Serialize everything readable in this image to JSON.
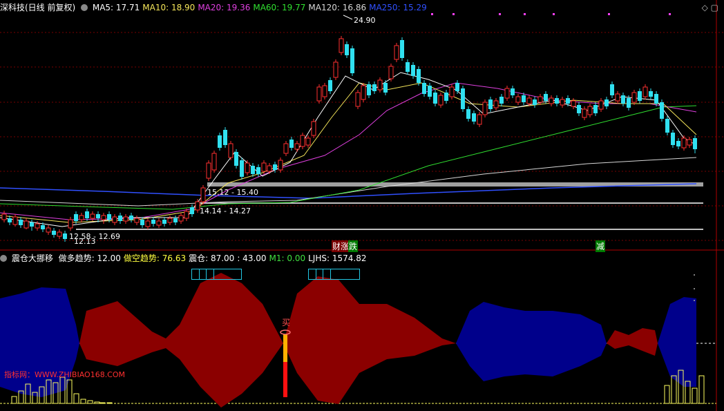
{
  "main_header": {
    "title": "深科技(日线 前复权)",
    "ma": [
      {
        "label": "MA5: 17.71",
        "color": "#ffffff"
      },
      {
        "label": "MA10: 18.90",
        "color": "#f5e65a"
      },
      {
        "label": "MA20: 19.36",
        "color": "#e040e0"
      },
      {
        "label": "MA60: 19.77",
        "color": "#30e030"
      },
      {
        "label": "MA120: 16.86",
        "color": "#d8d8d8"
      },
      {
        "label": "MA250: 15.29",
        "color": "#3050ff"
      }
    ]
  },
  "price_annotations": {
    "high": "24.90",
    "zone1": "15.12 - 15.40",
    "zone2": "14.14 - 14.27",
    "low": "12.13",
    "zone3": "12.58 - 12.69"
  },
  "events": [
    {
      "text": "财",
      "color": "#ffffff",
      "bg": "#7a0000"
    },
    {
      "text": "涨",
      "color": "#ffffff",
      "bg": "#7a0000"
    },
    {
      "text": "跌",
      "color": "#ffffff",
      "bg": "#007a00"
    },
    {
      "text": "减",
      "color": "#ffffff",
      "bg": "#007a00"
    }
  ],
  "indicator_header": {
    "name": "震仓大挪移",
    "items": [
      {
        "label": "做多趋势: 12.00",
        "color": "#ffffff"
      },
      {
        "label": "做空趋势: 76.63",
        "color": "#ffff40"
      },
      {
        "label": "震仓: 87.00",
        "color": "#ffffff"
      },
      {
        "label": ": 43.00",
        "color": "#ffffff"
      },
      {
        "label": "M1: 0.00",
        "color": "#40e040"
      },
      {
        "label": "LJHS: 1574.82",
        "color": "#ffffff"
      }
    ]
  },
  "buy_label": "买",
  "watermark": "指标网：WWW.ZHIBIAO168.COM",
  "colors": {
    "up": "#ff3030",
    "down": "#30e0f0",
    "bull_area": "#8b0000",
    "bear_area": "#00008b",
    "bar_yellow": "#ffff60"
  }
}
